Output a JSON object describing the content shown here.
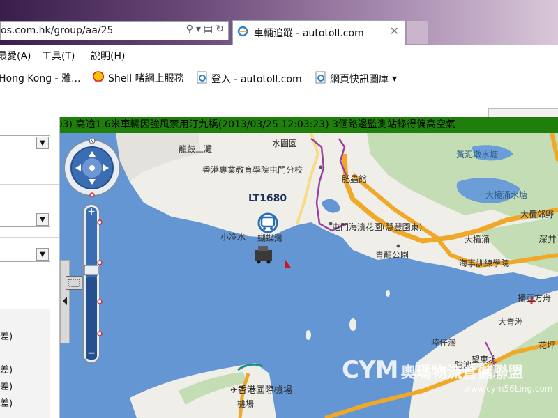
{
  "browser": {
    "address_url": "os.com.hk/group/aa/25",
    "tab_title": "車輛追蹤 - autotoll.com",
    "tab_close": "✕"
  },
  "menu": [
    "最愛(A)",
    "工具(T)",
    "說明(H)"
  ],
  "favorites": [
    {
      "label": "Hong Kong - 雅...",
      "icon": "none"
    },
    {
      "label": "Shell 啫網上服務",
      "icon": "shell-icon"
    },
    {
      "label": "登入 - autotoll.com",
      "icon": "ie-page-icon"
    },
    {
      "label": "網頁快訊圖庫",
      "icon": "ie-page-icon",
      "dropdown": "▾"
    }
  ],
  "marquee": ":03)    高逾1.6米車輛因強風禁用汀九橋(2013/03/25 12:03:23)    3個路邊監測站錄得偏高空氣",
  "left_panel": {
    "list_items": [
      "差)",
      "差)",
      "差)",
      "差)"
    ]
  },
  "map": {
    "vehicle_label": "LT1680",
    "labels": [
      {
        "text": "龍鼓上灘",
        "cls": "",
        "l": 170,
        "t": 14
      },
      {
        "text": "水圍園",
        "cls": "",
        "l": 304,
        "t": 6
      },
      {
        "text": "香港專業教育學院屯門分校",
        "cls": "",
        "l": 204,
        "t": 44
      },
      {
        "text": "肥蟲館",
        "cls": "",
        "l": 404,
        "t": 57
      },
      {
        "text": "小冷水",
        "cls": "",
        "l": 230,
        "t": 140
      },
      {
        "text": "蝴蝶灣",
        "cls": "",
        "l": 283,
        "t": 142
      },
      {
        "text": "屯門海濱花園(慧豐園東)",
        "cls": "",
        "l": 390,
        "t": 126
      },
      {
        "text": "青龍公園",
        "cls": "",
        "l": 452,
        "t": 166
      },
      {
        "text": "海事訓練學院",
        "cls": "",
        "l": 572,
        "t": 178
      },
      {
        "text": "大欖涌",
        "cls": "",
        "l": 580,
        "t": 144
      },
      {
        "text": "黃泥墩水塘",
        "cls": "blue",
        "l": 568,
        "t": 22
      },
      {
        "text": "大欖涌水塘",
        "cls": "blue",
        "l": 610,
        "t": 80
      },
      {
        "text": "大欖郊野",
        "cls": "",
        "l": 660,
        "t": 108
      },
      {
        "text": "深井",
        "cls": "big",
        "l": 686,
        "t": 142
      },
      {
        "text": "掃亞方舟",
        "cls": "",
        "l": 656,
        "t": 228
      },
      {
        "text": "大青洲",
        "cls": "",
        "l": 628,
        "t": 262
      },
      {
        "text": "陸仔灣",
        "cls": "",
        "l": 532,
        "t": 292
      },
      {
        "text": "望東坑",
        "cls": "",
        "l": 590,
        "t": 316
      },
      {
        "text": "花坪",
        "cls": "",
        "l": 686,
        "t": 296
      },
      {
        "text": "陰澳",
        "cls": "",
        "l": 566,
        "t": 324
      },
      {
        "text": "✈香港國際機場",
        "cls": "big",
        "l": 244,
        "t": 358
      },
      {
        "text": "機場",
        "cls": "",
        "l": 254,
        "t": 380
      }
    ]
  },
  "watermark": {
    "logo": "CYM",
    "title": "奧瑪物流倉儲聯盟",
    "url": "www.cym56Ling.com"
  },
  "controls": {
    "zoom_in": "+",
    "zoom_out": "−"
  },
  "colors": {
    "marquee_bg": "#1f7f0c",
    "sea": "#6396d2",
    "land": "#efeee9",
    "green": "#c5ddb4",
    "highway": "#f0a829"
  }
}
